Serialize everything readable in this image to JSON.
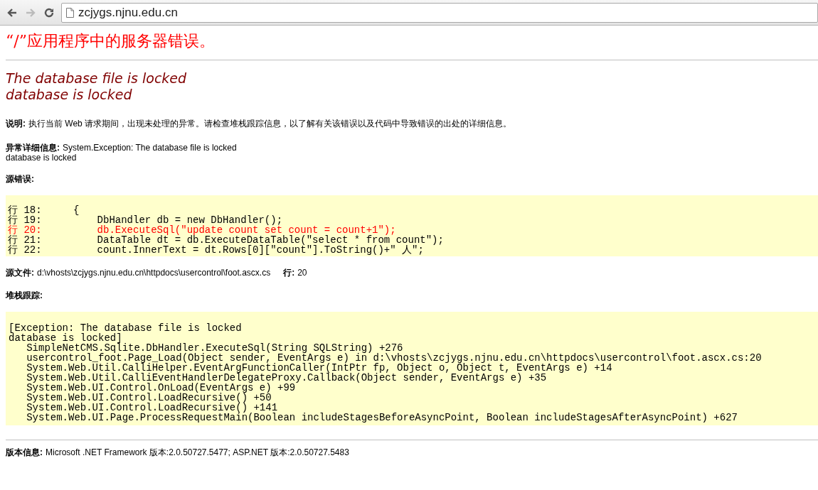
{
  "browser": {
    "back_disabled": false,
    "forward_disabled": true,
    "url": "zcjygs.njnu.edu.cn"
  },
  "page": {
    "title": "“/”应用程序中的服务器错误。",
    "error_lines": [
      "The database file is locked",
      "database is locked"
    ],
    "description": {
      "label": "说明:",
      "text": "执行当前 Web 请求期间，出现未处理的异常。请检查堆栈跟踪信息，以了解有关该错误以及代码中导致错误的出处的详细信息。"
    },
    "exception_details": {
      "label": "异常详细信息:",
      "lines": [
        "System.Exception: The database file is locked",
        "database is locked"
      ]
    },
    "source_error": {
      "label": "源错误:",
      "lines": [
        {
          "number": "行 18:",
          "code": "{",
          "highlighted": false
        },
        {
          "number": "行 19:",
          "code": "    DbHandler db = new DbHandler();",
          "highlighted": false
        },
        {
          "number": "行 20:",
          "code": "    db.ExecuteSql(\"update count set count = count+1\");",
          "highlighted": true
        },
        {
          "number": "行 21:",
          "code": "    DataTable dt = db.ExecuteDataTable(\"select * from count\");",
          "highlighted": false
        },
        {
          "number": "行 22:",
          "code": "    count.InnerText = dt.Rows[0][\"count\"].ToString()+\" 人\";",
          "highlighted": false
        }
      ]
    },
    "source_file": {
      "label": "源文件:",
      "path": "d:\\vhosts\\zcjygs.njnu.edu.cn\\httpdocs\\usercontrol\\foot.ascx.cs",
      "line_label": "行:",
      "line": "20"
    },
    "stack_trace": {
      "label": "堆栈跟踪:",
      "lines": [
        "[Exception: The database file is locked",
        "database is locked]",
        "   SimpleNetCMS.Sqlite.DbHandler.ExecuteSql(String SQLString) +276",
        "   usercontrol_foot.Page_Load(Object sender, EventArgs e) in d:\\vhosts\\zcjygs.njnu.edu.cn\\httpdocs\\usercontrol\\foot.ascx.cs:20",
        "   System.Web.Util.CalliHelper.EventArgFunctionCaller(IntPtr fp, Object o, Object t, EventArgs e) +14",
        "   System.Web.Util.CalliEventHandlerDelegateProxy.Callback(Object sender, EventArgs e) +35",
        "   System.Web.UI.Control.OnLoad(EventArgs e) +99",
        "   System.Web.UI.Control.LoadRecursive() +50",
        "   System.Web.UI.Control.LoadRecursive() +141",
        "   System.Web.UI.Page.ProcessRequestMain(Boolean includeStagesBeforeAsyncPoint, Boolean includeStagesAfterAsyncPoint) +627"
      ]
    },
    "version": {
      "label": "版本信息:",
      "text": "Microsoft .NET Framework 版本:2.0.50727.5477; ASP.NET 版本:2.0.50727.5483"
    }
  }
}
